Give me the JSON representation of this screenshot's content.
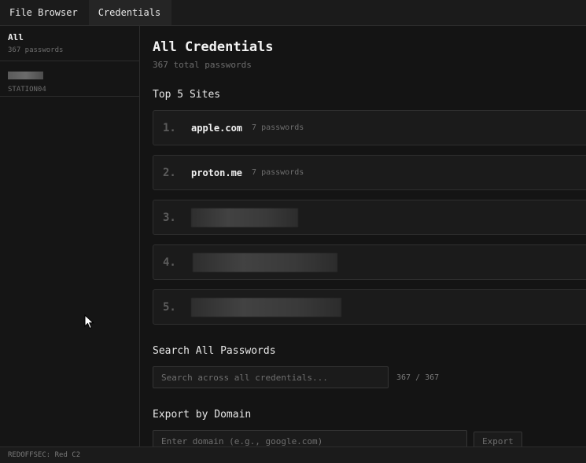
{
  "tabs": [
    {
      "label": "File Browser"
    },
    {
      "label": "Credentials"
    }
  ],
  "sidebar": {
    "items": [
      {
        "title": "All",
        "sub": "367 passwords"
      },
      {
        "title": "",
        "sub": "STATION04"
      }
    ]
  },
  "main": {
    "title": "All Credentials",
    "subtitle": "367 total passwords",
    "top_sites_heading": "Top 5 Sites",
    "sites": [
      {
        "rank": "1.",
        "name": "apple.com",
        "count": "7 passwords"
      },
      {
        "rank": "2.",
        "name": "proton.me",
        "count": "7 passwords"
      },
      {
        "rank": "3.",
        "name": "",
        "count": ""
      },
      {
        "rank": "4.",
        "name": "",
        "count": ""
      },
      {
        "rank": "5.",
        "name": "",
        "count": ""
      }
    ],
    "search_heading": "Search All Passwords",
    "search_placeholder": "Search across all credentials...",
    "search_count": "367 / 367",
    "export_heading": "Export by Domain",
    "domain_placeholder": "Enter domain (e.g., google.com)",
    "export_label": "Export"
  },
  "statusbar": {
    "text": "REDOFFSEC: Red C2"
  }
}
